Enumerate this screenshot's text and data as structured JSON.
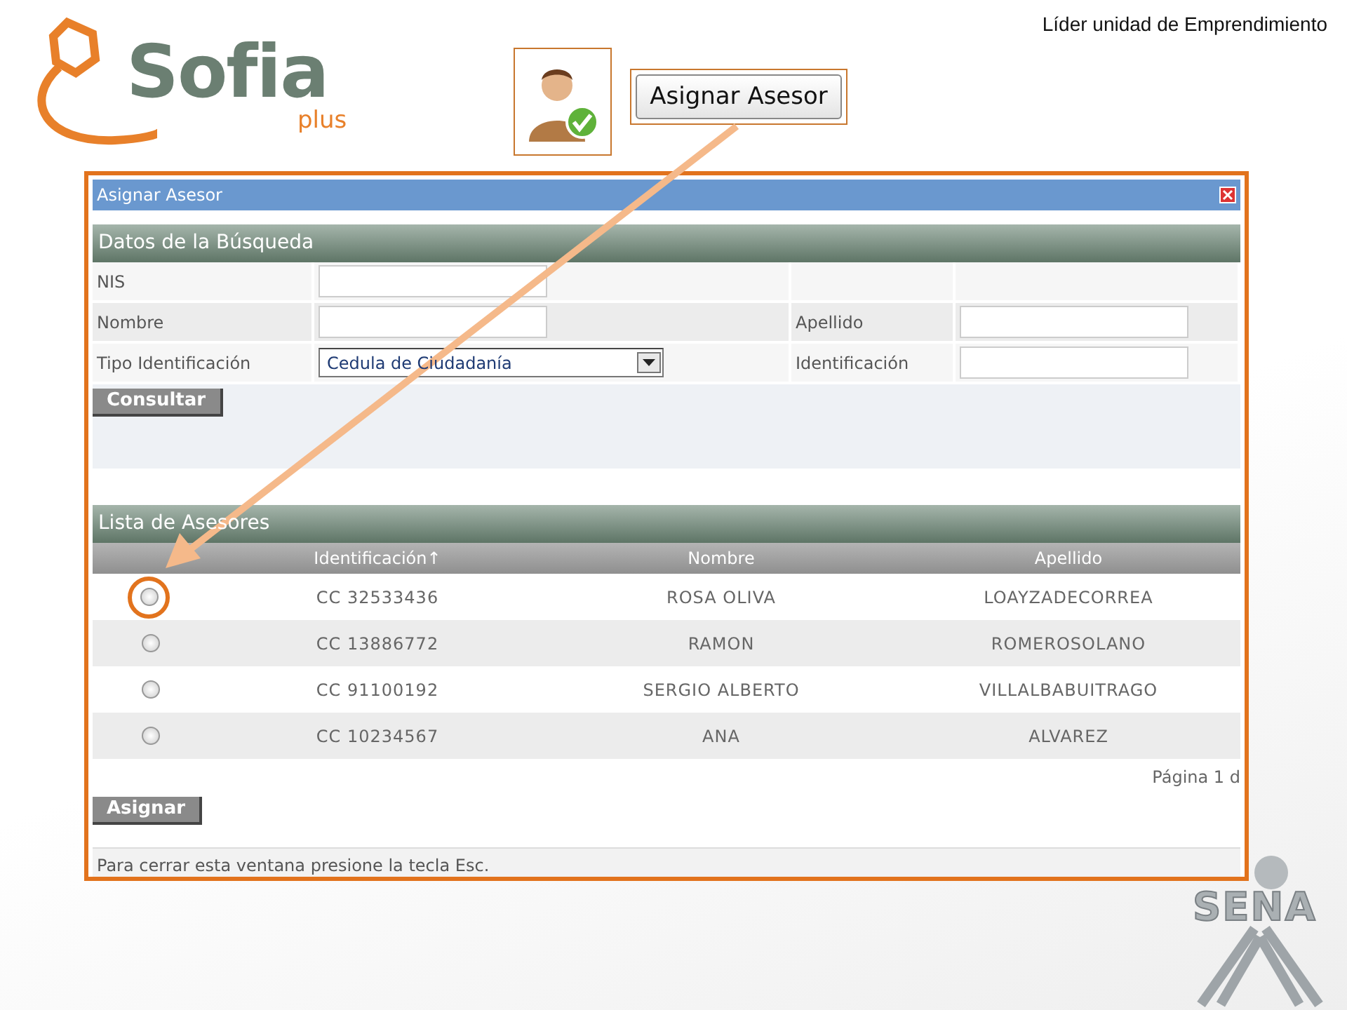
{
  "header": {
    "role_label": "Líder unidad de Emprendimiento",
    "logo": {
      "name": "Sofia",
      "sub": "plus"
    },
    "action_button": "Asignar Asesor"
  },
  "dialog": {
    "title": "Asignar Asesor",
    "search": {
      "heading": "Datos de la Búsqueda",
      "fields": [
        {
          "label": "NIS",
          "kind": "text"
        },
        {
          "label": "Nombre",
          "kind": "text"
        },
        {
          "label": "Apellido",
          "kind": "text"
        },
        {
          "label": "Tipo Identificación",
          "kind": "select",
          "value": "Cedula de Ciudadanía"
        },
        {
          "label": "Identificación",
          "kind": "text"
        }
      ],
      "button": "Consultar"
    },
    "list": {
      "heading": "Lista de Asesores",
      "columns": [
        "Identificación↑",
        "Nombre",
        "Apellido"
      ],
      "rows": [
        {
          "selected": false,
          "highlighted": true,
          "cells": [
            "CC 32533436",
            "ROSA OLIVA",
            "LOAYZADECORREA"
          ]
        },
        {
          "selected": false,
          "highlighted": false,
          "cells": [
            "CC 13886772",
            "RAMON",
            "ROMEROSOLANO"
          ]
        },
        {
          "selected": false,
          "highlighted": false,
          "cells": [
            "CC 91100192",
            "SERGIO ALBERTO",
            "VILLALBABUITRAGO"
          ]
        },
        {
          "selected": false,
          "highlighted": false,
          "cells": [
            "CC 10234567",
            "ANA",
            "ALVAREZ"
          ]
        }
      ],
      "pager": "Página 1 d",
      "button": "Asignar"
    },
    "footer": "Para cerrar esta ventana presione la tecla Esc."
  },
  "corner_logo": "SENA"
}
